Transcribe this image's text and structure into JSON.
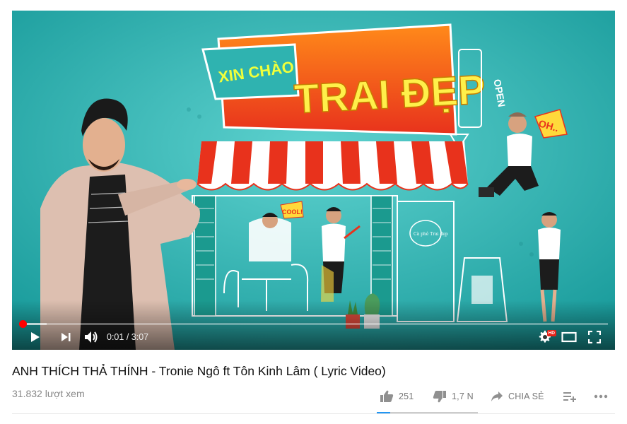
{
  "player": {
    "current_time": "0:01",
    "duration": "3:07",
    "time_separator": "/",
    "played_fraction": 0.006,
    "buffered_fraction": 0.047,
    "hd_badge": "HD",
    "thumbnail": {
      "sign_small": "XIN CHÀO",
      "sign_big": "TRAI ĐẸP",
      "open_sign": "OPEN",
      "speech_oh": "OH..",
      "speech_cool": "COOL!",
      "door_text": "Cà phê Trai đẹp"
    },
    "icons": {
      "play": "play-icon",
      "next": "next-icon",
      "volume": "volume-icon",
      "settings": "gear-icon",
      "theater": "theater-icon",
      "fullscreen": "fullscreen-icon"
    }
  },
  "video": {
    "title": "ANH THÍCH THẢ THÍNH - Tronie Ngô ft Tôn Kinh Lâm ( Lyric Video)",
    "views": "31.832 lượt xem"
  },
  "actions": {
    "like_count": "251",
    "dislike_count": "1,7 N",
    "share_label": "CHIA SẺ",
    "like_fraction": 0.13
  },
  "colors": {
    "accent_red": "#ff0000",
    "like_blue": "#2196f3",
    "bg_teal": "#2bb2b2"
  }
}
